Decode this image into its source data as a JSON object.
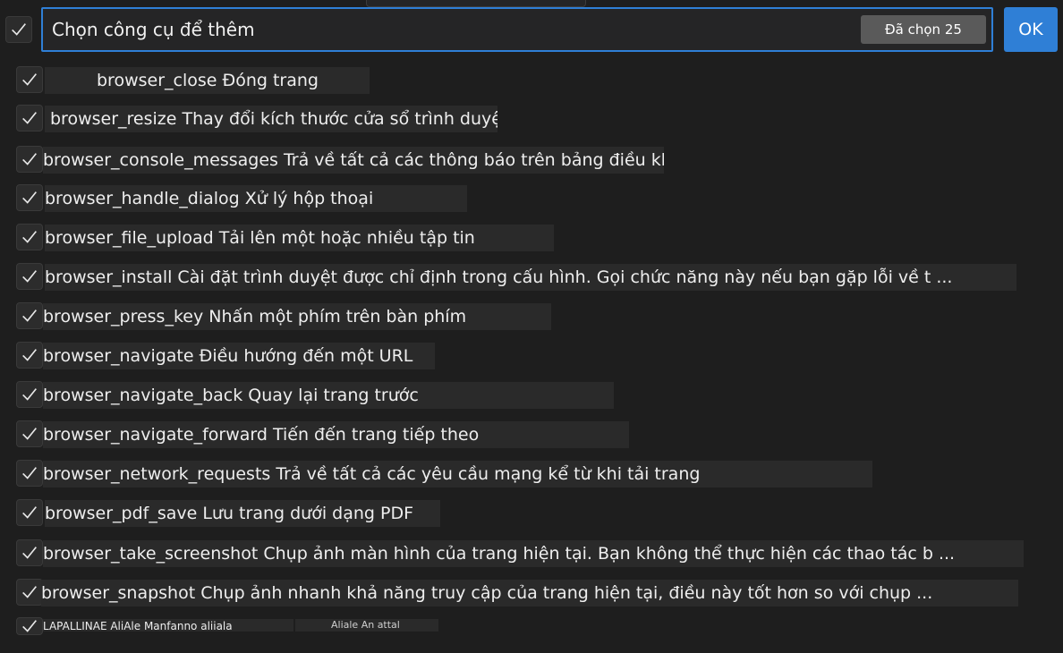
{
  "header": {
    "search_placeholder": "Chọn công cụ để thêm",
    "selected_badge": "Đã chọn 25",
    "ok_label": "OK"
  },
  "tools": [
    {
      "text": "browser_close Đóng trang"
    },
    {
      "text": "browser_resize Thay đổi kích thước cửa sổ trình duyệt"
    },
    {
      "text": "browser_console_messages Trả về tất cả các thông báo trên bảng điều khiển"
    },
    {
      "text": "browser_handle_dialog Xử lý hộp thoại"
    },
    {
      "text": "browser_file_upload Tải lên một hoặc nhiều tập tin"
    },
    {
      "text": "browser_install Cài đặt trình duyệt được chỉ định trong cấu hình. Gọi chức năng này nếu bạn gặp lỗi về t ..."
    },
    {
      "text": "browser_press_key Nhấn một phím trên bàn phím"
    },
    {
      "text": "browser_navigate Điều hướng đến một URL"
    },
    {
      "text": "browser_navigate_back Quay lại trang trước"
    },
    {
      "text": "browser_navigate_forward Tiến đến trang tiếp theo"
    },
    {
      "text": "browser_network_requests Trả về tất cả các yêu cầu mạng kể từ khi tải trang"
    },
    {
      "text": "browser_pdf_save Lưu trang dưới dạng PDF"
    },
    {
      "text": "browser_take_screenshot Chụp ảnh màn hình của trang hiện tại. Bạn không thể thực hiện các thao tác b ..."
    },
    {
      "text": "browser_snapshot Chụp ảnh nhanh khả năng truy cập của trang hiện tại, điều này tốt hơn so với chụp ..."
    }
  ],
  "partial_row": {
    "text": "LAPALLINAE AliAle Manfanno aliiala",
    "text2": "Aliale An attal"
  }
}
